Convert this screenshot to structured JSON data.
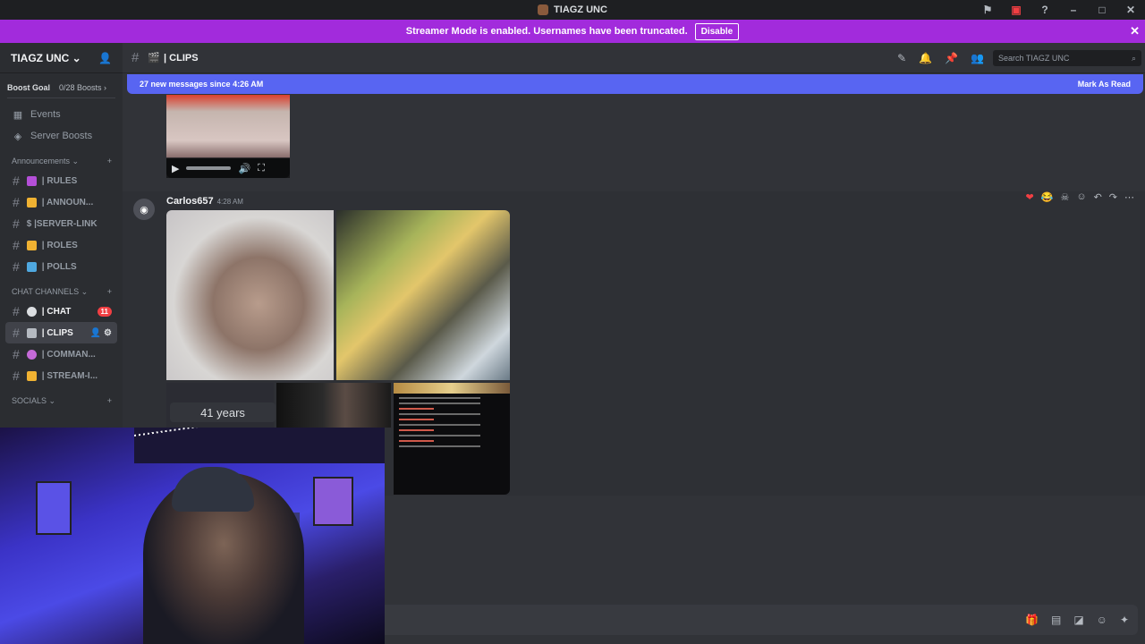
{
  "titlebar": {
    "title": "TIAGZ UNC",
    "icons": [
      "flag-icon",
      "monitor-icon",
      "help-icon"
    ],
    "window_controls": [
      "–",
      "□",
      "✕"
    ]
  },
  "streamer": {
    "text": "Streamer Mode is enabled. Usernames have been truncated.",
    "button": "Disable",
    "close": "✕"
  },
  "server": {
    "name": "TIAGZ UNC",
    "chevron": "⌄",
    "add_user_icon": "add-user-icon"
  },
  "boost": {
    "label": "Boost Goal",
    "count": "0/28 Boosts ›"
  },
  "side_links": [
    {
      "icon": "calendar-icon",
      "label": "Events"
    },
    {
      "icon": "boost-icon",
      "label": "Server Boosts"
    }
  ],
  "categories": {
    "announcements": "Announcements ⌄",
    "chat": "CHAT CHANNELS ⌄",
    "socials": "SOCIALS ⌄"
  },
  "announce_channels": [
    {
      "label": "| RULES",
      "color": "#b44fd8"
    },
    {
      "label": "| ANNOUN...",
      "color": "#f0b232"
    },
    {
      "label": "$ |SERVER-LINK",
      "color": ""
    },
    {
      "label": "| ROLES",
      "color": "#f0b232"
    },
    {
      "label": "| POLLS",
      "color": "#4fa8e0"
    }
  ],
  "chat_channels": [
    {
      "label": "| CHAT",
      "color": "#dbdee1",
      "badge": "11"
    },
    {
      "label": "| CLIPS",
      "color": "#b5bac1"
    },
    {
      "label": "| COMMAN...",
      "color": "#c56ad8"
    },
    {
      "label": "| STREAM-I...",
      "color": "#f0b232"
    }
  ],
  "channel_header": {
    "name": "| CLIPS",
    "search_placeholder": "Search TIAGZ UNC"
  },
  "new_messages": {
    "text": "27 new messages since 4:26 AM",
    "mark_read": "Mark As Read"
  },
  "message": {
    "author": "Carlos657",
    "time": "4:28 AM",
    "years_label": "41 years"
  },
  "reactions": [
    "❤",
    "😂",
    "☠"
  ],
  "composer_icons": [
    "gift-icon",
    "gif-icon",
    "sticker-icon",
    "emoji-icon",
    "apps-icon"
  ]
}
